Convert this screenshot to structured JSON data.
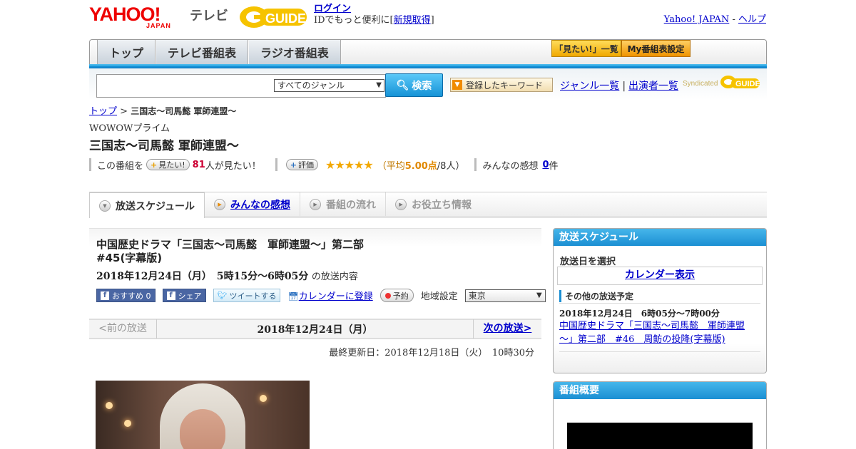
{
  "header": {
    "yahoo_logo": "YAHOO!",
    "yahoo_sub": "JAPAN",
    "tv_label": "テレビ",
    "gguide_logo": "GUIDE",
    "login_link": "ログイン",
    "login_text": "IDでもっと便利に[",
    "signup_link": "新規取得",
    "signup_close": "]",
    "yahoo_japan_link": "Yahoo! JAPAN",
    "dash": "-",
    "help_link": "ヘルプ"
  },
  "nav": {
    "tabs": [
      "トップ",
      "テレビ番組表",
      "ラジオ番組表"
    ],
    "mitai_list": "「見たい!」一覧",
    "my_table": "My番組表設定"
  },
  "search": {
    "genre_selected": "すべてのジャンル",
    "button": "検索",
    "keyword_btn": "登録したキーワード",
    "genre_list": "ジャンル一覧",
    "sep": "|",
    "cast_list": "出演者一覧",
    "syndicated": "Syndicated",
    "synd_logo": "GUIDE"
  },
  "breadcrumb": {
    "top": "トップ",
    "arrow": ">",
    "current": "三国志～司馬懿 軍師連盟～"
  },
  "program": {
    "channel": "WOWOWプライム",
    "title": "三国志～司馬懿 軍師連盟～",
    "this_program": "この番組を",
    "mitai_btn": "見たい!",
    "mitai_count": "81",
    "mitai_suffix": "人が見たい！",
    "rate_btn": "評価",
    "stars": "★★★★★",
    "avg_open": "（平均",
    "avg_value": "5.00点",
    "avg_people": "/8人）",
    "impressions_label": "みんなの感想",
    "impressions_count": "0",
    "impressions_unit": "件"
  },
  "content_tabs": [
    "放送スケジュール",
    "みんなの感想",
    "番組の流れ",
    "お役立ち情報"
  ],
  "episode": {
    "title_line1": "中国歴史ドラマ「三国志～司馬懿　軍師連盟～」第二部",
    "title_line2": "#45(字幕版)",
    "datetime": "2018年12月24日（月）　5時15分～6時05分",
    "datetime_tail": "の放送内容",
    "recommend": "おすすめ 0",
    "share": "シェア",
    "tweet": "ツイートする",
    "calendar": "カレンダーに登録",
    "reserve": "予約",
    "region_label": "地域設定",
    "region_value": "東京"
  },
  "epnav": {
    "prev": "<前の放送",
    "date": "2018年12月24日（月）",
    "next": "次の放送>"
  },
  "updated": "最終更新日：2018年12月18日（火）　10時30分",
  "sidebar": {
    "schedule_title": "放送スケジュール",
    "select_day": "放送日を選択",
    "calendar_btn": "カレンダー表示",
    "other_header": "その他の放送予定",
    "other_time": "2018年12月24日　6時05分～7時00分",
    "other_link": "中国歴史ドラマ「三国志～司馬懿　軍師連盟～」第二部　#46　周鲂の投降(字幕版)",
    "overview_title": "番組概要"
  },
  "colors": {
    "accent_blue": "#1b8fd3",
    "link": "#0000cc",
    "star": "#f2a800",
    "yahoo_red": "#ee0000"
  }
}
